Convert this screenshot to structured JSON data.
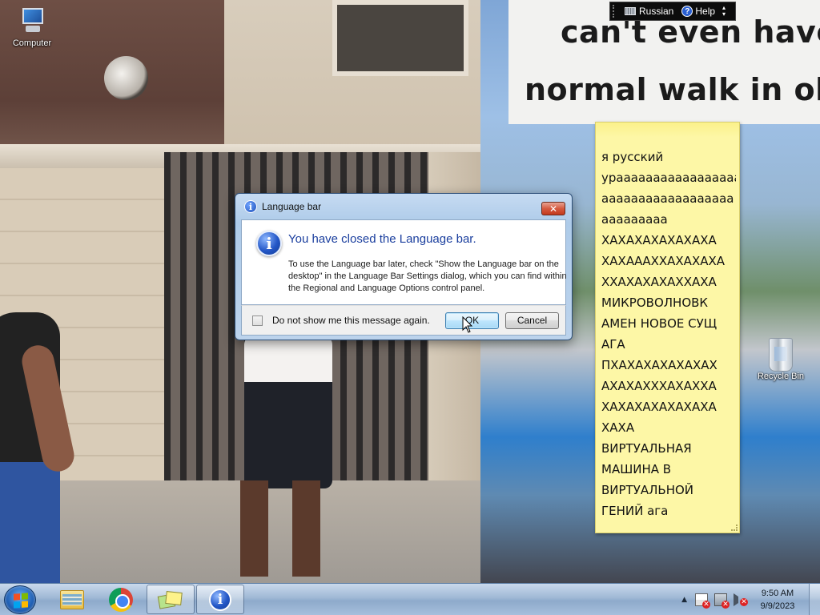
{
  "desktop": {
    "icons": [
      {
        "label": "Computer",
        "icon": "computer-icon"
      },
      {
        "label": "Recycle Bin",
        "icon": "recycle-bin-icon"
      }
    ],
    "wallpaper_caption": {
      "line1": "can't even have",
      "line2": "normal walk in ol"
    }
  },
  "language_bar": {
    "language": "Russian",
    "help": "Help"
  },
  "sticky_note": {
    "lines": [
      "я русский",
      "урааааааааааааааааа",
      "аааааааааааааааааа",
      "ааааааааа",
      "ХАХАХАХАХАХАХА",
      "ХАХАААХХАХАХАХА",
      "ХХАХАХАХАХХАХА",
      "МИКРОВОЛНОВК",
      "АМЕН НОВОЕ СУЩ",
      "АГА",
      "ПХАХАХАХАХАХАХ",
      "АХАХАХХХАХАХХА",
      "ХАХАХАХАХАХАХА",
      "ХАХА",
      "ВИРТУАЛЬНАЯ",
      "МАШИНА В",
      "ВИРТУАЛЬНОЙ",
      "ГЕНИЙ ага"
    ]
  },
  "dialog": {
    "title": "Language bar",
    "close_glyph": "✕",
    "heading": "You have closed the Language bar.",
    "body": "To use the Language bar later, check \"Show the Language bar on the desktop\" in the Language Bar Settings dialog, which you can find within the Regional and Language Options control panel.",
    "checkbox_label": "Do not show me this message again.",
    "checkbox_checked": false,
    "ok_label": "OK",
    "cancel_label": "Cancel"
  },
  "taskbar": {
    "pinned": [
      {
        "name": "explorer",
        "icon": "folder-icon"
      },
      {
        "name": "chrome",
        "icon": "chrome-icon"
      },
      {
        "name": "sticky-notes",
        "icon": "sticky-notes-icon",
        "active": true
      },
      {
        "name": "language-bar-dialog",
        "icon": "info-icon",
        "active": true
      }
    ],
    "time": "9:50 AM",
    "date": "9/9/2023"
  },
  "colors": {
    "dialog_heading": "#1a3e9e",
    "sticky_note": "#fdf7a6",
    "close_button": "#c3391d"
  }
}
